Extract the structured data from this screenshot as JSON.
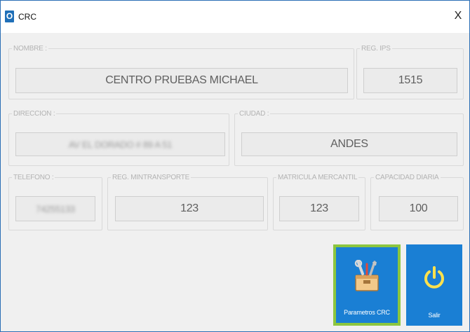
{
  "window": {
    "title": "CRC",
    "app_icon_glyph": "O",
    "close_glyph": "X"
  },
  "groups": {
    "nombre": {
      "label": "NOMBRE :",
      "value": "CENTRO PRUEBAS MICHAEL"
    },
    "reg_ips": {
      "label": "REG. IPS",
      "value": "1515"
    },
    "direccion": {
      "label": "DIRECCION :",
      "value": "AV EL DORADO # 89 A 51"
    },
    "ciudad": {
      "label": "CIUDAD :",
      "value": "ANDES"
    },
    "telefono": {
      "label": "TELEFONO :",
      "value": "74255133"
    },
    "reg_mintransporte": {
      "label": "REG. MINTRANSPORTE",
      "value": "123"
    },
    "matricula_mercantil": {
      "label": "MATRICULA MERCANTIL",
      "value": "123"
    },
    "capacidad_diaria": {
      "label": "CAPACIDAD DIARIA",
      "value": "100"
    }
  },
  "buttons": {
    "parametros": {
      "label": "Parametros CRC",
      "icon": "tools-box-icon"
    },
    "salir": {
      "label": "Salir",
      "icon": "power-icon"
    }
  },
  "colors": {
    "tile_blue": "#1a7fd4",
    "focus_green": "#8cc63f",
    "power_yellow": "#ffe14d",
    "window_border": "#2b6fb5"
  }
}
